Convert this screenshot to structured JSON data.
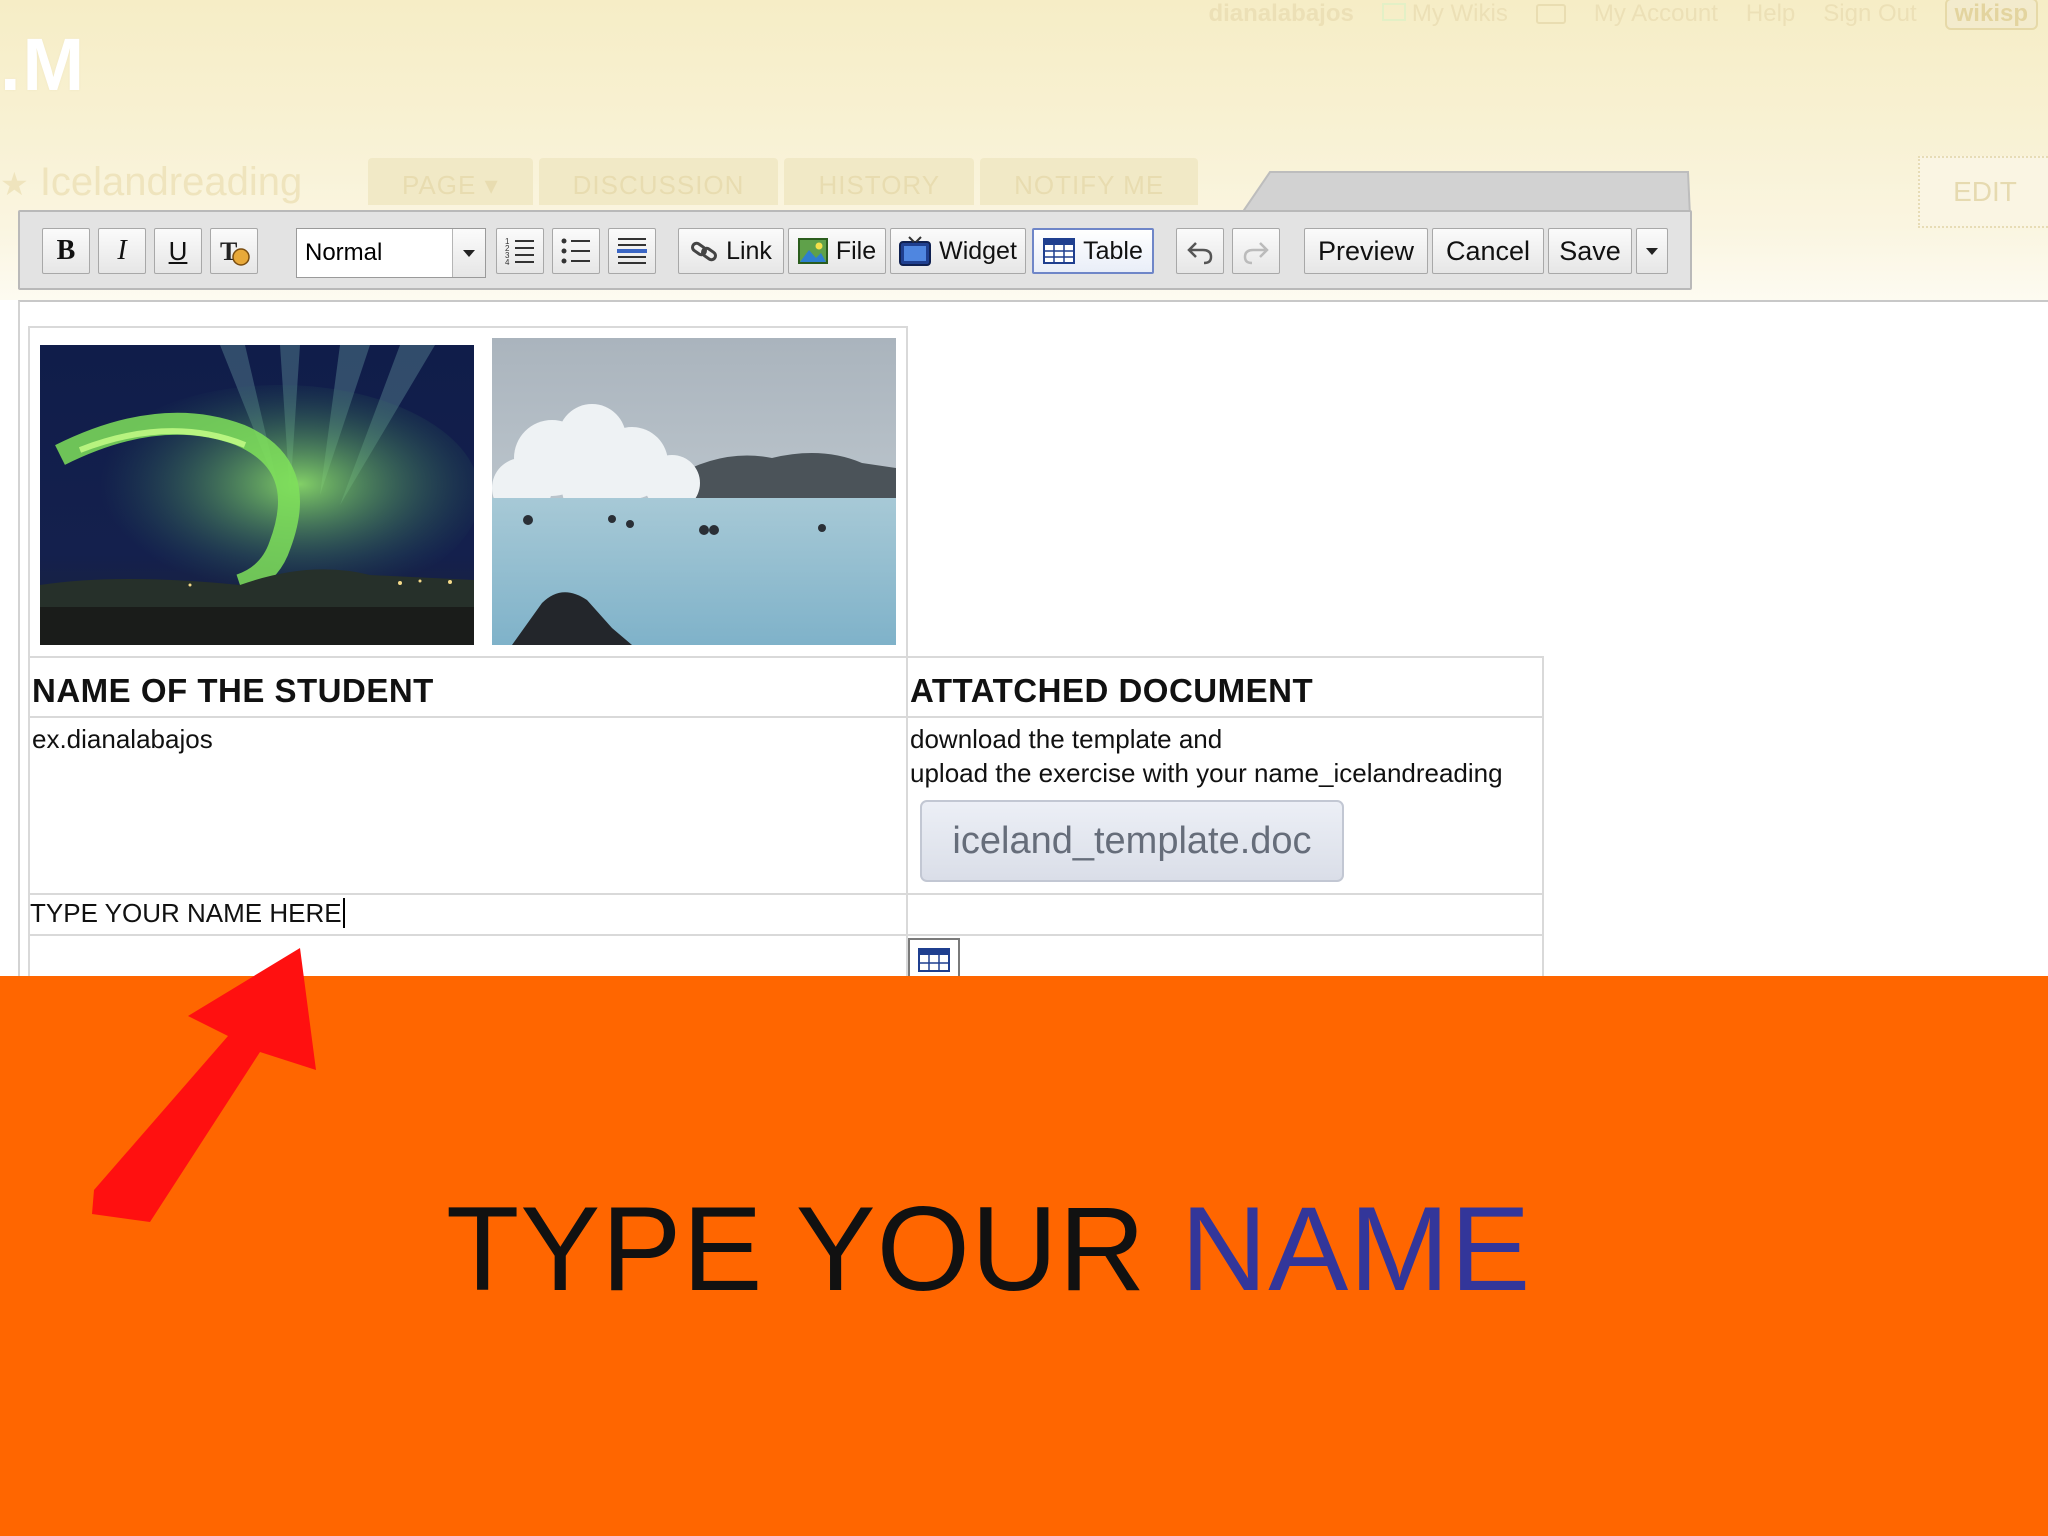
{
  "header": {
    "username": "dianalabajos",
    "links": [
      "My Wikis",
      "My Account",
      "Help",
      "Sign Out"
    ],
    "brand_badge": "wikisp",
    "logo_text": ".M",
    "wiki_title": "Icelandreading",
    "tabs": [
      "PAGE",
      "DISCUSSION",
      "HISTORY",
      "NOTIFY ME"
    ],
    "edit_label": "EDIT"
  },
  "toolbar": {
    "bold": "B",
    "italic": "I",
    "underline": "U",
    "style_select": "Normal",
    "link_label": "Link",
    "file_label": "File",
    "widget_label": "Widget",
    "table_label": "Table",
    "preview_label": "Preview",
    "cancel_label": "Cancel",
    "save_label": "Save"
  },
  "table": {
    "col1_header": "NAME OF THE STUDENT",
    "col2_header": "ATTATCHED DOCUMENT",
    "example_name": "ex.dianalabajos",
    "instructions_line1": "download the template and",
    "instructions_line2": "upload the exercise with your name_icelandreading",
    "attachment": "iceland_template.doc",
    "name_entry": "TYPE YOUR NAME HERE"
  },
  "caption": {
    "part1": "TYPE YOUR ",
    "part2": "NAME"
  },
  "colors": {
    "overlay": "#ff6600",
    "caption_accent": "#33369a",
    "arrow": "#ff1010"
  }
}
